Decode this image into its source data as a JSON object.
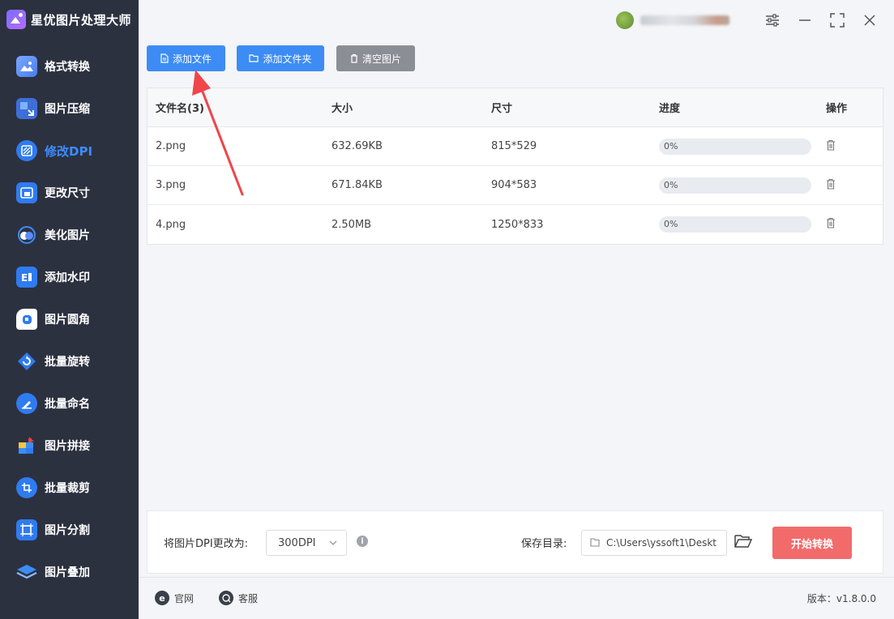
{
  "app": {
    "title": "星优图片处理大师"
  },
  "sidebar": {
    "items": [
      {
        "label": "格式转换",
        "icon": "image-convert-icon"
      },
      {
        "label": "图片压缩",
        "icon": "compress-icon"
      },
      {
        "label": "修改DPI",
        "icon": "dpi-icon",
        "active": true
      },
      {
        "label": "更改尺寸",
        "icon": "resize-icon"
      },
      {
        "label": "美化图片",
        "icon": "beautify-icon"
      },
      {
        "label": "添加水印",
        "icon": "watermark-icon"
      },
      {
        "label": "图片圆角",
        "icon": "rounded-corner-icon"
      },
      {
        "label": "批量旋转",
        "icon": "rotate-icon"
      },
      {
        "label": "批量命名",
        "icon": "rename-icon"
      },
      {
        "label": "图片拼接",
        "icon": "puzzle-icon"
      },
      {
        "label": "批量裁剪",
        "icon": "crop-icon"
      },
      {
        "label": "图片分割",
        "icon": "split-icon"
      },
      {
        "label": "图片叠加",
        "icon": "layers-icon"
      }
    ]
  },
  "toolbar": {
    "add_file": "添加文件",
    "add_folder": "添加文件夹",
    "clear": "清空图片"
  },
  "table": {
    "headers": [
      "文件名(3)",
      "大小",
      "尺寸",
      "进度",
      "操作"
    ],
    "rows": [
      {
        "name": "2.png",
        "size": "632.69KB",
        "dims": "815*529",
        "progress": "0%"
      },
      {
        "name": "3.png",
        "size": "671.84KB",
        "dims": "904*583",
        "progress": "0%"
      },
      {
        "name": "4.png",
        "size": "2.50MB",
        "dims": "1250*833",
        "progress": "0%"
      }
    ]
  },
  "settings": {
    "dpi_label": "将图片DPI更改为:",
    "dpi_value": "300DPI",
    "save_label": "保存目录:",
    "save_path": "C:\\Users\\yssoft1\\Deskt",
    "start_button": "开始转换"
  },
  "footer": {
    "website": "官网",
    "support": "客服",
    "version": "版本：v1.8.0.0"
  },
  "colors": {
    "sidebar_bg": "#2c3140",
    "accent_blue": "#3d8cf5",
    "start_red": "#f26b6b",
    "annotation_arrow": "#f0454a"
  }
}
